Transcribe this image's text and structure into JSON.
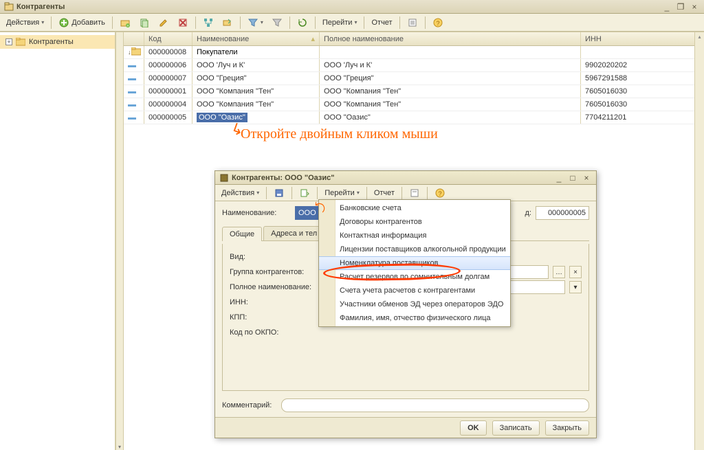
{
  "window": {
    "title": "Контрагенты",
    "winbtns": {
      "min": "_",
      "max": "❐",
      "close": "×"
    }
  },
  "toolbar": {
    "actions": "Действия",
    "add": "Добавить",
    "goto": "Перейти",
    "report": "Отчет"
  },
  "tree": {
    "root": "Контрагенты"
  },
  "columns": {
    "code": "Код",
    "name": "Наименование",
    "fullname": "Полное наименование",
    "inn": "ИНН"
  },
  "rows": [
    {
      "icon": "folder",
      "code": "000000008",
      "name": "Покупатели",
      "fullname": "",
      "inn": "",
      "mark": "↓"
    },
    {
      "icon": "item",
      "code": "000000006",
      "name": "ООО 'Луч и К'",
      "fullname": "ООО 'Луч и К'",
      "inn": "9902020202"
    },
    {
      "icon": "item",
      "code": "000000007",
      "name": "ООО \"Греция\"",
      "fullname": "ООО \"Греция\"",
      "inn": "5967291588"
    },
    {
      "icon": "item",
      "code": "000000001",
      "name": "ООО \"Компания \"Тен\"",
      "fullname": "ООО \"Компания \"Тен\"",
      "inn": "7605016030"
    },
    {
      "icon": "item",
      "code": "000000004",
      "name": "ООО \"Компания \"Тен\"",
      "fullname": "ООО \"Компания \"Тен\"",
      "inn": "7605016030"
    },
    {
      "icon": "item",
      "code": "000000005",
      "name": "ООО \"Оазис\"",
      "fullname": "ООО \"Оазис\"",
      "inn": "7704211201",
      "selected": true
    }
  ],
  "annotation": "Откройте двойным кликом мыши",
  "dialog": {
    "title": "Контрагенты: ООО \"Оазис\"",
    "toolbar": {
      "actions": "Действия",
      "goto": "Перейти",
      "report": "Отчет"
    },
    "fields": {
      "name_label": "Наименование:",
      "name_value": "ООО \"Оа",
      "code_label": "Код:",
      "code_value": "000000005",
      "tab_general": "Общие",
      "tab_addresses": "Адреса и тел",
      "kind_label": "Вид:",
      "group_label": "Группа контрагентов:",
      "fullname_label": "Полное наименование:",
      "inn_label": "ИНН:",
      "kpp_label": "КПП:",
      "okpo_label": "Код по ОКПО:",
      "comment_label": "Комментарий:"
    },
    "buttons": {
      "ok": "OK",
      "write": "Записать",
      "close": "Закрыть"
    }
  },
  "menu": {
    "items": [
      "Банковские счета",
      "Договоры контрагентов",
      "Контактная информация",
      "Лицензии поставщиков алкогольной продукции",
      "Номенклатура поставщиков",
      "Расчет резервов по сомнительным долгам",
      "Счета учета расчетов с контрагентами",
      "Участники обменов ЭД через операторов ЭДО",
      "Фамилия, имя, отчество физического лица"
    ],
    "hover_index": 4
  }
}
